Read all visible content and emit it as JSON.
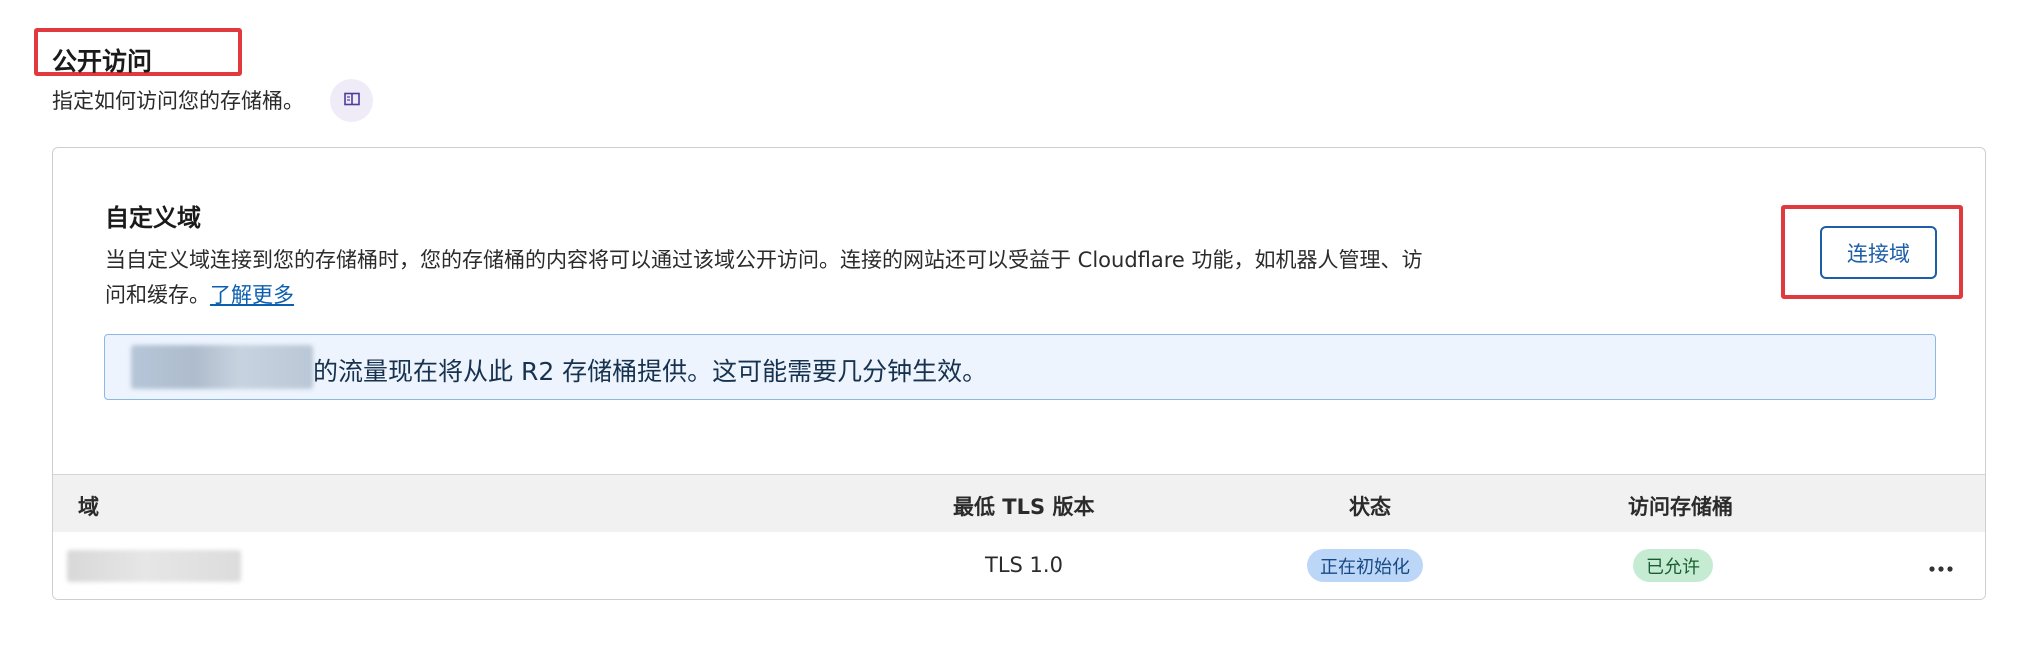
{
  "section": {
    "title": "公开访问",
    "description": "指定如何访问您的存储桶。",
    "docs_icon": "book-icon"
  },
  "custom_domains": {
    "title": "自定义域",
    "description": "当自定义域连接到您的存储桶时，您的存储桶的内容将可以通过该域公开访问。连接的网站还可以受益于 Cloudflare 功能，如机器人管理、访问和缓存。",
    "learn_more": "了解更多",
    "connect_button": "连接域",
    "notice_text": "的流量现在将从此 R2 存储桶提供。这可能需要几分钟生效。"
  },
  "table": {
    "headers": {
      "domain": "域",
      "min_tls": "最低 TLS 版本",
      "status": "状态",
      "access": "访问存储桶"
    },
    "rows": [
      {
        "tls": "TLS 1.0",
        "status": "正在初始化",
        "access": "已允许",
        "menu_icon": "more-horizontal-icon"
      }
    ]
  },
  "colors": {
    "highlight_box": "#e03a3e",
    "primary_blue": "#1d5ea8",
    "notice_bg": "#edf4fe",
    "status_badge_bg": "#bcd6f7",
    "allowed_badge_bg": "#c5ecd2"
  }
}
